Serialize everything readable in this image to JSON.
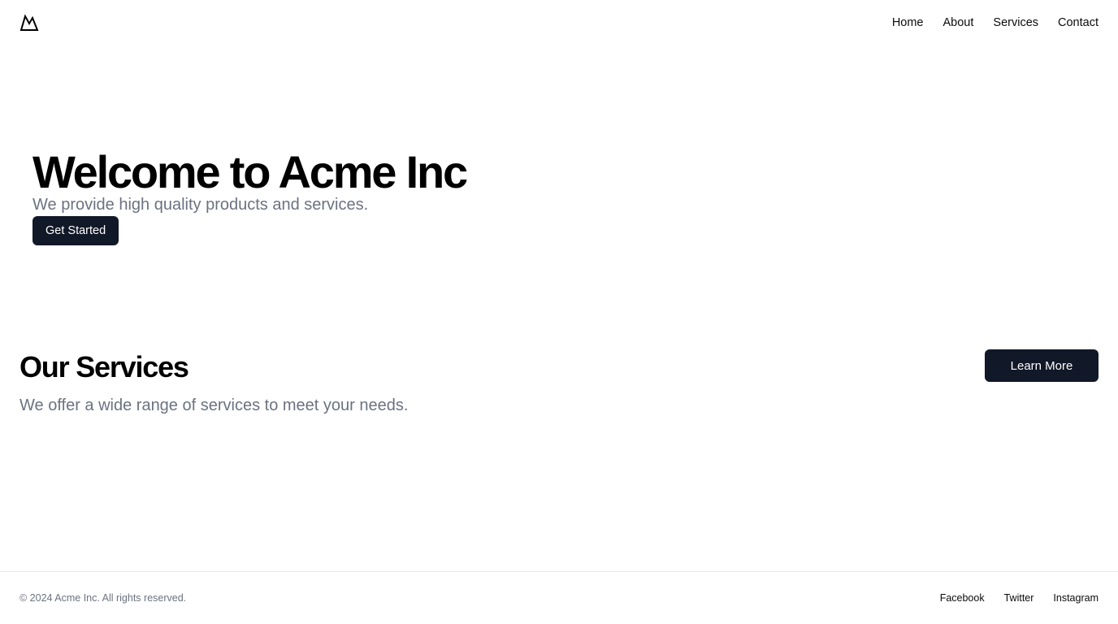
{
  "header": {
    "logo_icon": "mountain-icon",
    "nav": [
      {
        "label": "Home"
      },
      {
        "label": "About"
      },
      {
        "label": "Services"
      },
      {
        "label": "Contact"
      }
    ]
  },
  "hero": {
    "title": "Welcome to Acme Inc",
    "subtitle": "We provide high quality products and services.",
    "cta_label": "Get Started"
  },
  "services": {
    "title": "Our Services",
    "subtitle": "We offer a wide range of services to meet your needs.",
    "cta_label": "Learn More"
  },
  "footer": {
    "copyright": "© 2024 Acme Inc. All rights reserved.",
    "links": [
      {
        "label": "Facebook"
      },
      {
        "label": "Twitter"
      },
      {
        "label": "Instagram"
      }
    ]
  },
  "colors": {
    "button_bg": "#111827",
    "muted_text": "#6b7280",
    "divider": "#e5e7eb"
  }
}
